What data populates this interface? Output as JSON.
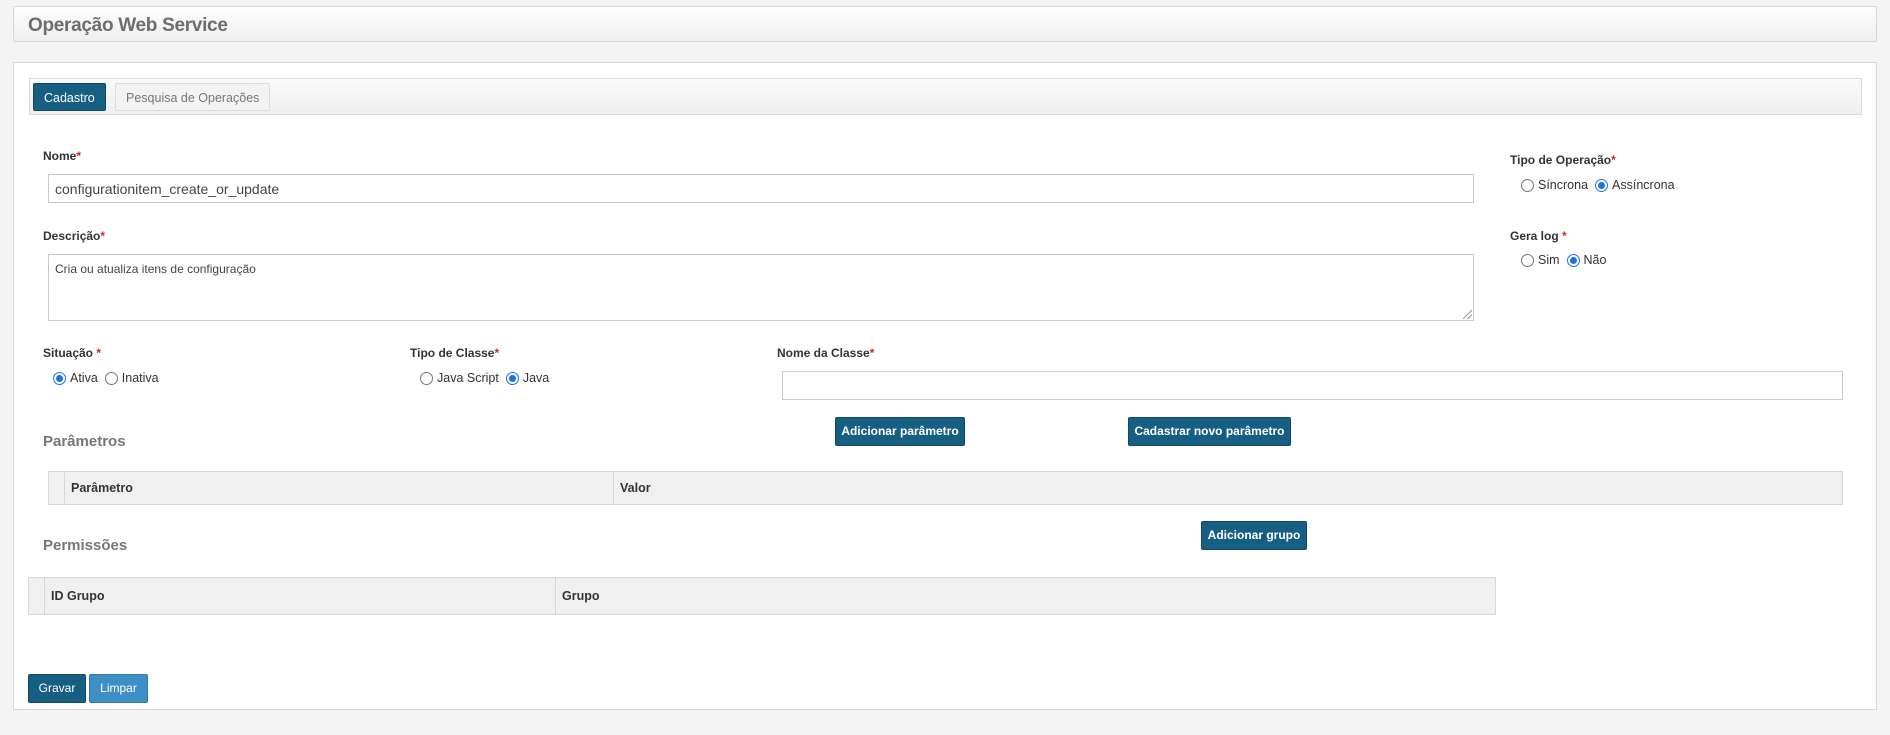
{
  "header": {
    "title": "Operação Web Service"
  },
  "tabs": [
    {
      "label": "Cadastro",
      "active": true
    },
    {
      "label": "Pesquisa de Operações",
      "active": false
    }
  ],
  "form": {
    "nome": {
      "label": "Nome",
      "value": "configurationitem_create_or_update"
    },
    "descricao": {
      "label": "Descrição",
      "value": "Cria ou atualiza itens de configuração"
    },
    "tipo_operacao": {
      "label": "Tipo de Operação",
      "options": [
        "Síncrona",
        "Assíncrona"
      ],
      "selected": "Assíncrona"
    },
    "gera_log": {
      "label": "Gera log ",
      "options": [
        "Sim",
        "Não"
      ],
      "selected": "Não"
    },
    "situacao": {
      "label": "Situação ",
      "options": [
        "Ativa",
        "Inativa"
      ],
      "selected": "Ativa"
    },
    "tipo_classe": {
      "label": "Tipo de Classe",
      "options": [
        "Java Script",
        "Java"
      ],
      "selected": "Java"
    },
    "nome_classe": {
      "label": "Nome da Classe",
      "value": ""
    }
  },
  "buttons": {
    "adicionar_parametro": "Adicionar parâmetro",
    "cadastrar_parametro": "Cadastrar novo parâmetro",
    "adicionar_grupo": "Adicionar grupo",
    "gravar": "Gravar",
    "limpar": "Limpar"
  },
  "parametros": {
    "title": "Parâmetros",
    "columns": [
      "Parâmetro",
      "Valor"
    ]
  },
  "permissoes": {
    "title": "Permissões",
    "columns": [
      "ID Grupo",
      "Grupo"
    ]
  },
  "colors": {
    "primary": "#175f82",
    "secondary": "#3d8fc6",
    "required": "#d0242a"
  }
}
